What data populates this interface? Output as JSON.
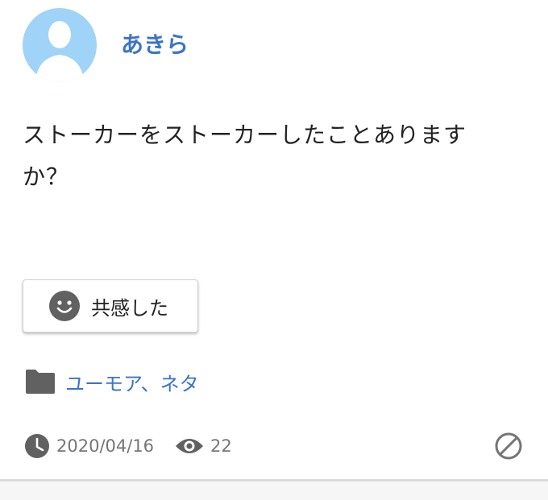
{
  "user": {
    "name": "あきら",
    "avatar_icon": "default-user-avatar"
  },
  "post": {
    "text": "ストーカーをストーカーしたことありますか？"
  },
  "empathy_button": {
    "icon": "smiley-face-icon",
    "label": "共感した"
  },
  "category": {
    "icon": "folder-icon",
    "label": "ユーモア、ネタ"
  },
  "meta": {
    "date_icon": "clock-icon",
    "date": "2020/04/16",
    "views_icon": "eye-icon",
    "views": "22",
    "block_icon": "block-icon"
  },
  "colors": {
    "accent": "#3d73c9",
    "avatar_bg": "#9fd3f7",
    "icon_gray": "#616161",
    "meta_gray": "#757575"
  }
}
